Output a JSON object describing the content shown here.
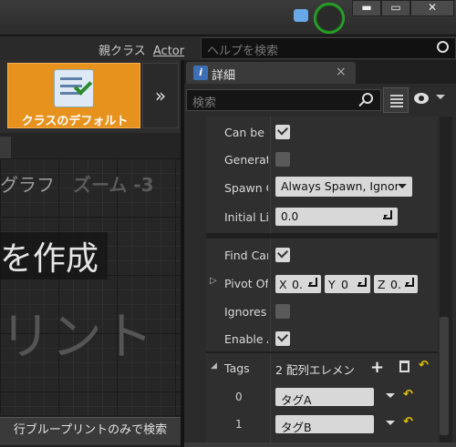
{
  "window": {
    "minimize": "▬",
    "maximize": "▭",
    "close": "✕"
  },
  "classbar": {
    "parent_class_label": "親クラス",
    "parent_class_value": "Actor",
    "help_search_placeholder": "ヘルプを検索"
  },
  "toolbar": {
    "class_defaults_label": "クラスのデフォルト",
    "expand": "»"
  },
  "graph": {
    "title": "グラフ",
    "zoom": "ズーム -3",
    "create_text": "を作成",
    "watermark": "リント",
    "search_this_blueprint": "行ブループリントのみで検索"
  },
  "details": {
    "tab_label": "詳細",
    "close": "×",
    "search_placeholder": "検索",
    "properties": [
      {
        "name": "Can be I",
        "type": "checkbox",
        "checked": true
      },
      {
        "name": "Generat",
        "type": "checkbox",
        "checked": false
      },
      {
        "name": "Spawn C",
        "type": "dropdown",
        "value": "Always Spawn, Ignor"
      },
      {
        "name": "Initial Li",
        "type": "number",
        "value": "0.0"
      }
    ],
    "properties2": [
      {
        "name": "Find Car",
        "type": "checkbox",
        "checked": true
      },
      {
        "name": "Pivot Of",
        "type": "vector",
        "x_label": "X",
        "x_value": "0.",
        "y_label": "Y",
        "y_value": "0",
        "z_label": "Z",
        "z_value": "0."
      },
      {
        "name": "Ignores",
        "type": "checkbox",
        "checked": false
      },
      {
        "name": "Enable A",
        "type": "checkbox",
        "checked": true
      }
    ],
    "tags": {
      "name": "Tags",
      "count_label": "2 配列エレメン",
      "items": [
        {
          "index": "0",
          "value": "タグA"
        },
        {
          "index": "1",
          "value": "タグB"
        }
      ]
    },
    "triangle_collapsed": "▷",
    "triangle_expanded": "◢"
  }
}
